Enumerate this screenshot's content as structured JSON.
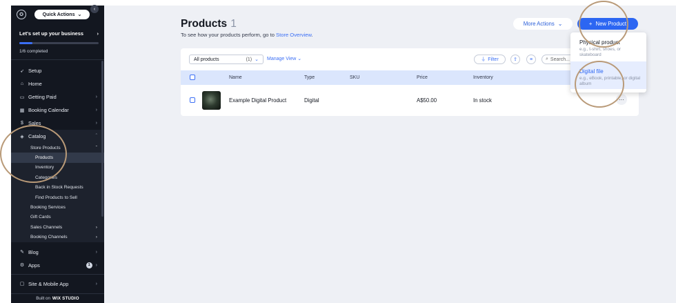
{
  "sidebar": {
    "quick_actions": "Quick Actions",
    "setup_title": "Let's set up your business",
    "progress_text": "1/6 completed",
    "progress_fraction": 0.1667,
    "items_top": [
      {
        "label": "Setup",
        "icon": "rocket-icon"
      },
      {
        "label": "Home",
        "icon": "home-icon"
      },
      {
        "label": "Getting Paid",
        "icon": "payment-icon"
      },
      {
        "label": "Booking Calendar",
        "icon": "calendar-icon"
      },
      {
        "label": "Sales",
        "icon": "sales-icon"
      },
      {
        "label": "Catalog",
        "icon": "catalog-icon"
      }
    ],
    "catalog_sub": {
      "store_products": "Store Products",
      "products": "Products",
      "inventory": "Inventory",
      "categories": "Categories",
      "back_in_stock": "Back in Stock Requests",
      "find_products": "Find Products to Sell",
      "booking_services": "Booking Services",
      "gift_cards": "Gift Cards",
      "sales_channels": "Sales Channels",
      "booking_channels": "Booking Channels"
    },
    "blog": "Blog",
    "apps": "Apps",
    "apps_badge": "1",
    "site_mobile": "Site & Mobile App",
    "footer_prefix": "Built on",
    "footer_brand": "WIX STUDIO"
  },
  "header": {
    "title": "Products",
    "count": "1",
    "subtitle_prefix": "To see how your products perform, go to",
    "subtitle_link": "Store Overview",
    "subtitle_suffix": ".",
    "more_actions": "More Actions",
    "new_product": "New Product"
  },
  "toolbar": {
    "filter_select": "All products",
    "filter_count": "(1)",
    "manage_view": "Manage View",
    "filter": "Filter",
    "search_placeholder": "Search..."
  },
  "table": {
    "columns": [
      "Name",
      "Type",
      "SKU",
      "Price",
      "Inventory"
    ],
    "rows": [
      {
        "name": "Example Digital Product",
        "type": "Digital",
        "sku": "",
        "price": "A$50.00",
        "inventory": "In stock"
      }
    ]
  },
  "dropdown": {
    "items": [
      {
        "title": "Physical product",
        "desc": "e.g., t-shirt, shoes, or skateboard"
      },
      {
        "title": "Digital file",
        "desc": "e.g., eBook, printable, or digital album"
      }
    ]
  },
  "colors": {
    "sidebar_bg": "#131720",
    "accent": "#2c66f2",
    "annotation": "#b99a78"
  }
}
